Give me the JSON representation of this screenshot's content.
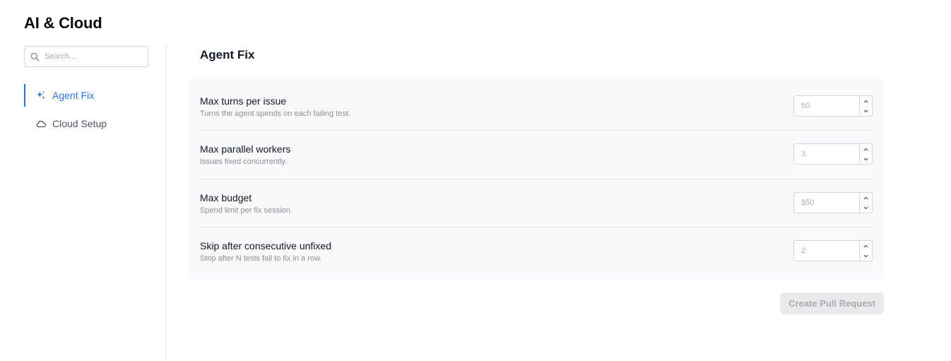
{
  "app": {
    "title": "AI & Cloud"
  },
  "search": {
    "placeholder": "Search...",
    "value": ""
  },
  "sidebar": {
    "items": [
      {
        "label": "Agent Fix",
        "icon": "sparkles-icon",
        "active": true
      },
      {
        "label": "Cloud Setup",
        "icon": "cloud-icon",
        "active": false
      }
    ]
  },
  "main": {
    "title": "Agent Fix",
    "settings": [
      {
        "label": "Max turns per issue",
        "description": "Turns the agent spends on each failing test.",
        "placeholder": "50"
      },
      {
        "label": "Max parallel workers",
        "description": "Issues fixed concurrently.",
        "placeholder": "3"
      },
      {
        "label": "Max budget",
        "description": "Spend limit per fix session.",
        "placeholder": "$50"
      },
      {
        "label": "Skip after consecutive unfixed",
        "description": "Stop after N tests fail to fix in a row.",
        "placeholder": "2"
      }
    ],
    "primary_button": "Create Pull Request"
  },
  "colors": {
    "accent": "#2f6fe0",
    "card_bg": "#f8f9fb",
    "button_disabled_bg": "#e9eaec",
    "button_disabled_text": "#a7abb2"
  }
}
